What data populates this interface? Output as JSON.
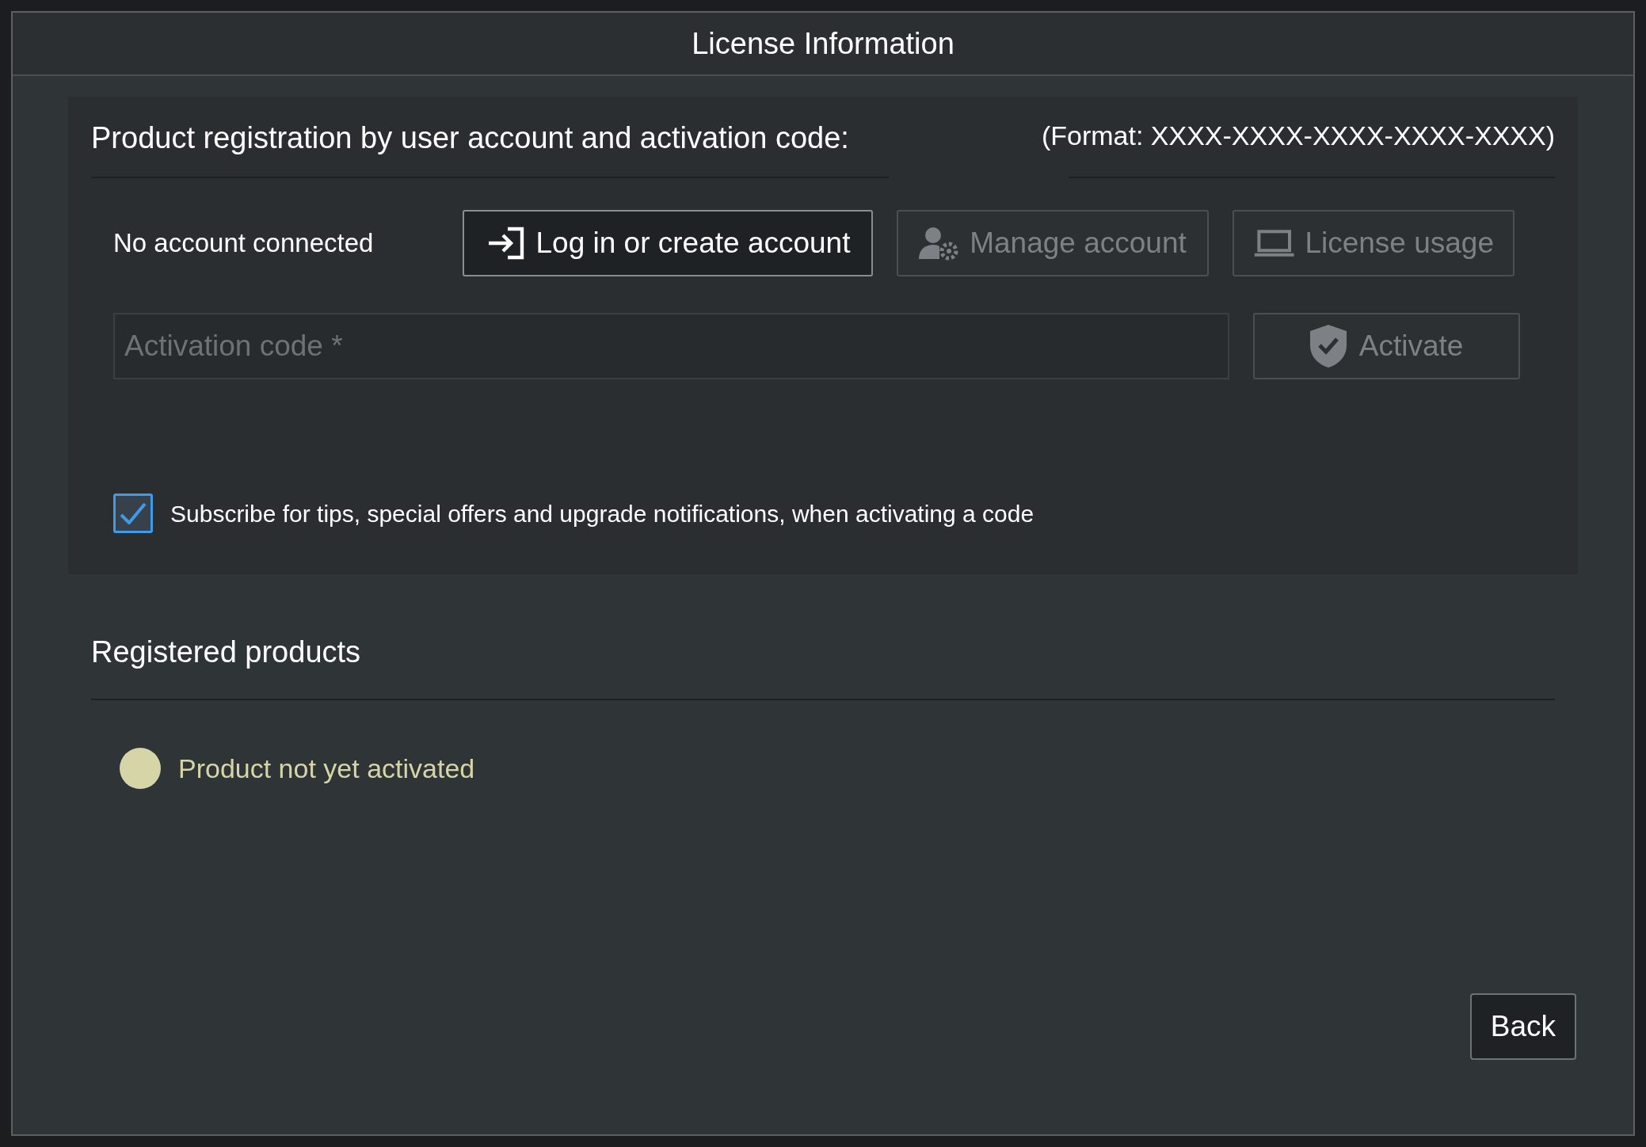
{
  "window": {
    "title": "License Information"
  },
  "registration": {
    "heading": "Product registration by user account and activation code:",
    "format_hint": "(Format: XXXX-XXXX-XXXX-XXXX-XXXX)",
    "account_status": "No account connected",
    "account_buttons": [
      {
        "kind": "login",
        "label": "Log in or create account",
        "disabled": false
      },
      {
        "kind": "manage",
        "label": "Manage account",
        "disabled": true
      },
      {
        "kind": "usage",
        "label": "License usage",
        "disabled": true
      }
    ],
    "activation_field": {
      "placeholder": "Activation code *"
    },
    "activate_button": {
      "label": "Activate",
      "disabled": true
    },
    "subscribe": {
      "label": "Subscribe for tips, special offers and upgrade notifications, when activating a code",
      "checked": true
    }
  },
  "registered_products": {
    "heading": "Registered products",
    "items": [
      {
        "label": "Product not yet activated",
        "color": "#d5d5a8"
      }
    ]
  },
  "buttons": [
    {
      "label": "Back"
    }
  ]
}
